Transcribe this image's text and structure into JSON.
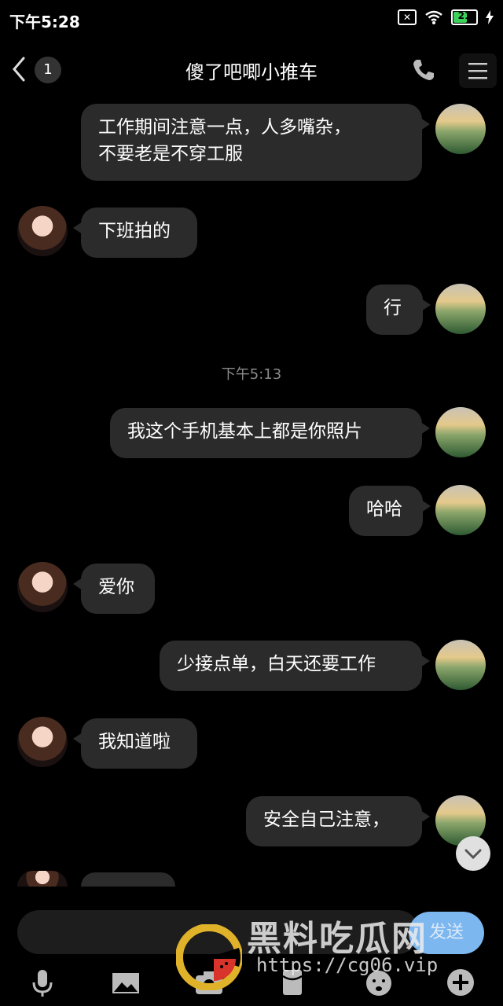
{
  "status_bar": {
    "time": "下午5:28",
    "battery": "21"
  },
  "header": {
    "unread_count": "1",
    "title": "傻了吧唧小推车"
  },
  "timestamp": "下午5:13",
  "messages": [
    {
      "side": "right",
      "lines": [
        "工作期间注意一点，人多嘴杂，",
        "不要老是不穿工服"
      ]
    },
    {
      "side": "left",
      "lines": [
        "下班拍的"
      ]
    },
    {
      "side": "right",
      "lines": [
        "行"
      ]
    },
    {
      "side": "right",
      "lines": [
        "我这个手机基本上都是你照片"
      ]
    },
    {
      "side": "right",
      "lines": [
        "哈哈"
      ]
    },
    {
      "side": "left",
      "lines": [
        "爱你"
      ]
    },
    {
      "side": "right",
      "lines": [
        "少接点单，白天还要工作"
      ]
    },
    {
      "side": "left",
      "lines": [
        "我知道啦"
      ]
    },
    {
      "side": "right",
      "lines": [
        "安全自己注意，"
      ]
    }
  ],
  "input": {
    "send_label": "发送"
  },
  "toolbar": {
    "icons": [
      "microphone-icon",
      "image-icon",
      "camera-icon",
      "red-packet-icon",
      "emoji-icon",
      "plus-icon"
    ]
  },
  "watermark": {
    "brand": "黑料吃瓜网",
    "url": "https://cg06.vip"
  }
}
